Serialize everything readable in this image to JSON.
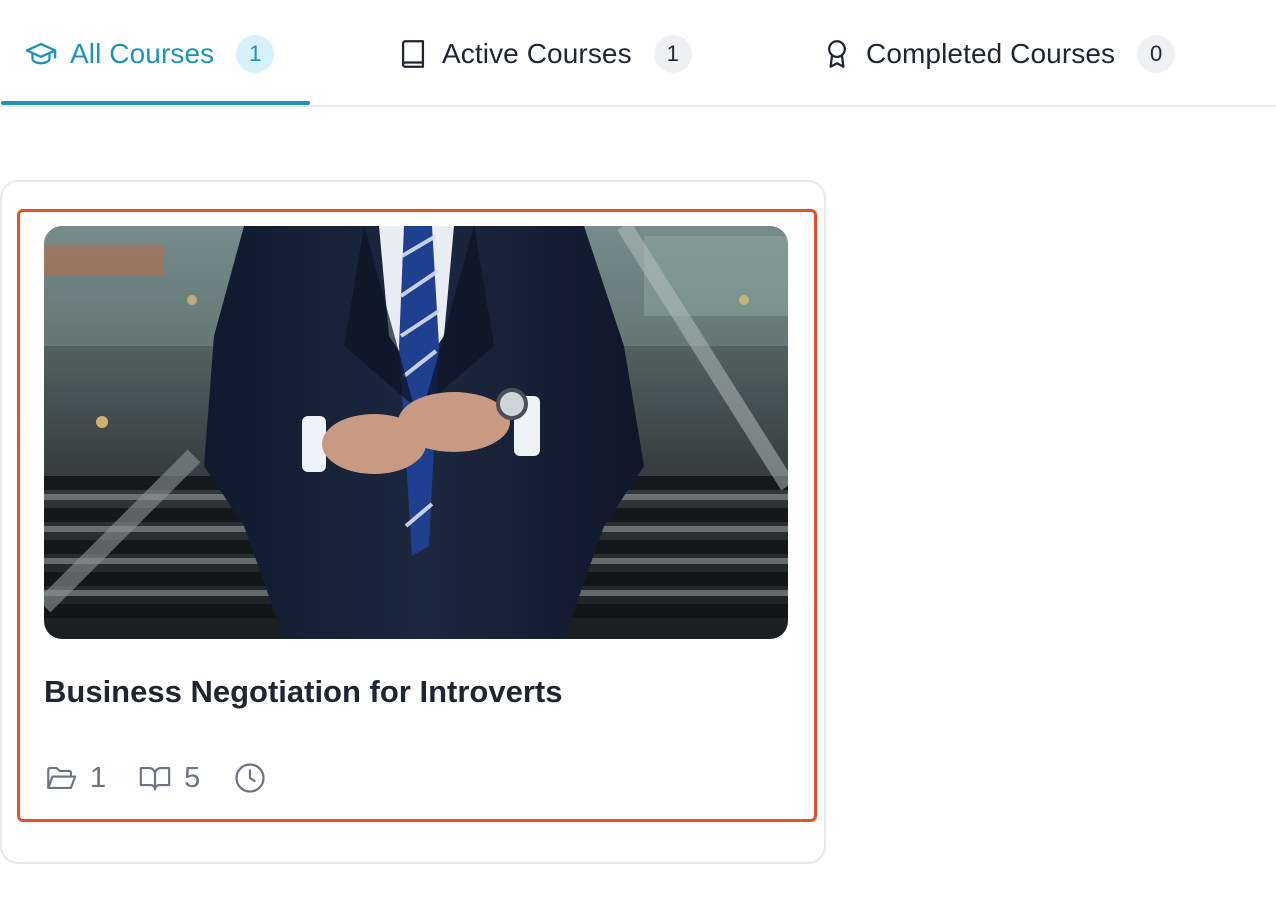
{
  "tabs": [
    {
      "label": "All Courses",
      "count": "1",
      "icon": "graduation-cap-icon",
      "active": true
    },
    {
      "label": "Active Courses",
      "count": "1",
      "icon": "book-icon",
      "active": false
    },
    {
      "label": "Completed Courses",
      "count": "0",
      "icon": "award-ribbon-icon",
      "active": false
    }
  ],
  "colors": {
    "accent": "#1c95b3",
    "focus_outline": "#e4512f",
    "text": "#1f2533",
    "muted": "#6b7280"
  },
  "course_card": {
    "title": "Business Negotiation for Introverts",
    "image_description_icon": "course-thumbnail-image",
    "meta": {
      "topics": "1",
      "lessons": "5",
      "duration_icon": "clock-icon"
    }
  }
}
